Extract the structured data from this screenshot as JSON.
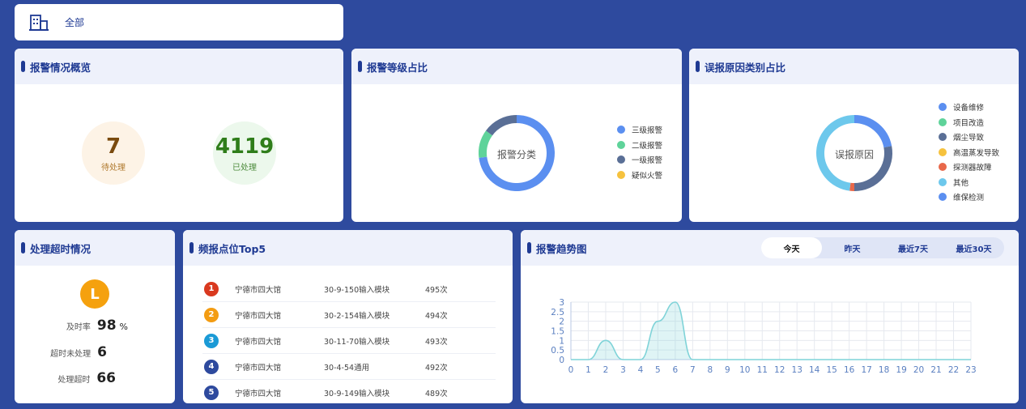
{
  "top": {
    "label": "全部",
    "icon": "building-icon"
  },
  "overview": {
    "title": "报警情况概览",
    "pending": {
      "value": "7",
      "label": "待处理"
    },
    "handled": {
      "value": "4119",
      "label": "已处理"
    }
  },
  "alarm_level": {
    "title": "报警等级占比",
    "center": "报警分类",
    "legend": [
      {
        "label": "三级报警",
        "color": "#5b8ff0"
      },
      {
        "label": "二级报警",
        "color": "#5fd39a"
      },
      {
        "label": "一级报警",
        "color": "#5a6f96"
      },
      {
        "label": "疑似火警",
        "color": "#f6c23e"
      }
    ],
    "slices": [
      0.73,
      0.12,
      0.15,
      0.0
    ]
  },
  "false_reason": {
    "title": "误报原因类别占比",
    "center": "误报原因",
    "legend": [
      {
        "label": "设备维修",
        "color": "#5b8ff0"
      },
      {
        "label": "项目改造",
        "color": "#5fd39a"
      },
      {
        "label": "烟尘导致",
        "color": "#5a6f96"
      },
      {
        "label": "高温蒸发导致",
        "color": "#f6c23e"
      },
      {
        "label": "探测器故障",
        "color": "#e8684a"
      },
      {
        "label": "其他",
        "color": "#6dc8ec"
      },
      {
        "label": "维保检测",
        "color": "#5b8ff0"
      }
    ],
    "slices": [
      0.22,
      0.0,
      0.28,
      0.0,
      0.02,
      0.48,
      0.0
    ]
  },
  "timeout": {
    "title": "处理超时情况",
    "icon_letter": "L",
    "rows": [
      {
        "label": "及时率",
        "value": "98",
        "unit": "%"
      },
      {
        "label": "超时未处理",
        "value": "6",
        "unit": ""
      },
      {
        "label": "处理超时",
        "value": "66",
        "unit": ""
      }
    ]
  },
  "top5": {
    "title": "频报点位Top5",
    "rows": [
      {
        "rank": "1",
        "place": "宁德市四大馆",
        "device": "30-9-150输入模块",
        "count": "495次",
        "color": "#d9391f"
      },
      {
        "rank": "2",
        "place": "宁德市四大馆",
        "device": "30-2-154输入模块",
        "count": "494次",
        "color": "#f39c12"
      },
      {
        "rank": "3",
        "place": "宁德市四大馆",
        "device": "30-11-70输入模块",
        "count": "493次",
        "color": "#1a9ad6"
      },
      {
        "rank": "4",
        "place": "宁德市四大馆",
        "device": "30-4-54通用",
        "count": "492次",
        "color": "#2e4a9e"
      },
      {
        "rank": "5",
        "place": "宁德市四大馆",
        "device": "30-9-149输入模块",
        "count": "489次",
        "color": "#2e4a9e"
      }
    ]
  },
  "trend": {
    "title": "报警趋势图",
    "tabs": [
      "今天",
      "昨天",
      "最近7天",
      "最近30天"
    ],
    "active_tab": 0
  },
  "chart_data": {
    "type": "area",
    "x": [
      0,
      1,
      2,
      3,
      4,
      5,
      6,
      7,
      8,
      9,
      10,
      11,
      12,
      13,
      14,
      15,
      16,
      17,
      18,
      19,
      20,
      21,
      22,
      23
    ],
    "series": [
      {
        "values": [
          0,
          0,
          1,
          0,
          0,
          2,
          3,
          0,
          0,
          0,
          0,
          0,
          0,
          0,
          0,
          0,
          0,
          0,
          0,
          0,
          0,
          0,
          0,
          0
        ]
      }
    ],
    "ylim": [
      0,
      3
    ],
    "yticks": [
      "0",
      "0.5",
      "1",
      "1.5",
      "2",
      "2.5",
      "3"
    ],
    "grid": true,
    "color": "#7fd3d8"
  }
}
